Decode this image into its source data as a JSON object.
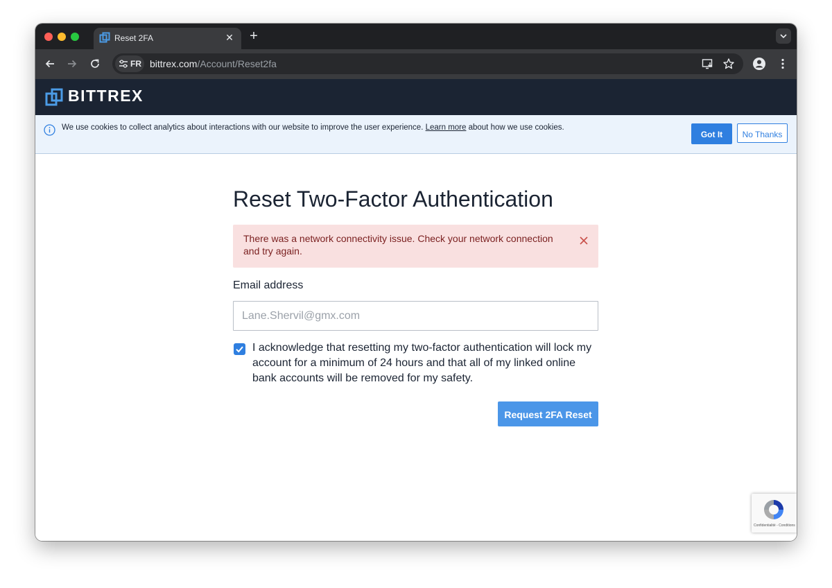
{
  "browser": {
    "tab_title": "Reset 2FA",
    "tab_close": "✕",
    "new_tab": "+",
    "site_chip_label": "FR",
    "url_host": "bittrex.com",
    "url_path": "/Account/Reset2fa"
  },
  "site": {
    "logo_text": "BITTREX",
    "header_color": "#1b2433",
    "accent_color": "#2f7fe0"
  },
  "cookie_banner": {
    "text_before": "We use cookies to collect analytics about interactions with our website to improve the user experience. ",
    "link_text": "Learn more",
    "text_after": " about how we use cookies.",
    "accept_label": "Got It",
    "decline_label": "No Thanks"
  },
  "form": {
    "title": "Reset Two-Factor Authentication",
    "error_message": "There was a network connectivity issue. Check your network connection and try again.",
    "email_label": "Email address",
    "email_placeholder": "Lane.Shervil@gmx.com",
    "acknowledge_checked": true,
    "acknowledge_text": "I acknowledge that resetting my two-factor authentication will lock my account for a minimum of 24 hours and that all of my linked online bank accounts will be removed for my safety.",
    "submit_label": "Request 2FA Reset"
  },
  "recaptcha": {
    "links_text": "Confidentialité - Conditions"
  }
}
